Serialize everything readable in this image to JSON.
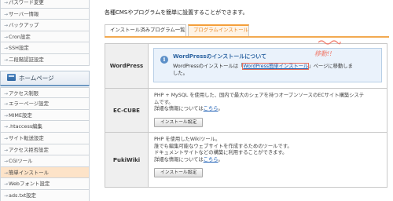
{
  "sidebar": {
    "items_top": [
      {
        "label": "パスワード変更"
      },
      {
        "label": "サーバー情報"
      },
      {
        "label": "バックアップ"
      },
      {
        "label": "Cron設定"
      },
      {
        "label": "SSH設定"
      },
      {
        "label": "二段階認証設定"
      }
    ],
    "section_title": "ホームページ",
    "items_home": [
      {
        "label": "アクセス制限"
      },
      {
        "label": "エラーページ設定"
      },
      {
        "label": "MIME設定"
      },
      {
        "label": ".htaccess編集"
      },
      {
        "label": "サイト転送設定"
      },
      {
        "label": "アクセス拒否設定"
      },
      {
        "label": "CGIツール"
      },
      {
        "label": "簡単インストール"
      },
      {
        "label": "Webフォント設定"
      },
      {
        "label": "ads.txt設定"
      }
    ],
    "active_item": "簡単インストール"
  },
  "main": {
    "description": "各種CMSやプログラムを簡単に設置することができます。",
    "tabs": [
      {
        "label": "インストール済みプログラム一覧"
      },
      {
        "label": "プログラムインストール"
      }
    ],
    "active_tab": "プログラムインストール",
    "rows": [
      {
        "name": "WordPress",
        "info_title": "WordPressのインストールについて",
        "info_text_before": "WordPressのインストールは「",
        "info_link": "WordPress簡単インストール",
        "info_text_after": "」ページに移動しま",
        "info_text_line2": "した。"
      },
      {
        "name": "EC-CUBE",
        "text_line1": "PHP + MySQL を使用した、国内で最大のシェアを持つオープンソースのECサイト構築システ",
        "text_line2": "ムです。",
        "detail_prefix": "詳細な情報については",
        "detail_link": "こちら",
        "detail_suffix": "。",
        "button": "インストール設定"
      },
      {
        "name": "PukiWiki",
        "text_line1": "PHP を使用したWikiツール。",
        "text_line2": "誰でも編集可能なウェブサイトを作成するためのツールです。",
        "text_line3": "ドキュメントサイトなどの構築に利用することができます。",
        "detail_prefix": "詳細な情報については",
        "detail_link": "こちら",
        "detail_suffix": "。",
        "button": "インストール設定"
      }
    ],
    "annotation": "移動!!"
  },
  "colors": {
    "accent_orange": "#f49f3a",
    "link_blue": "#2061b6",
    "info_bg": "#eaf2fb",
    "annotation_red": "#f07a6a"
  }
}
